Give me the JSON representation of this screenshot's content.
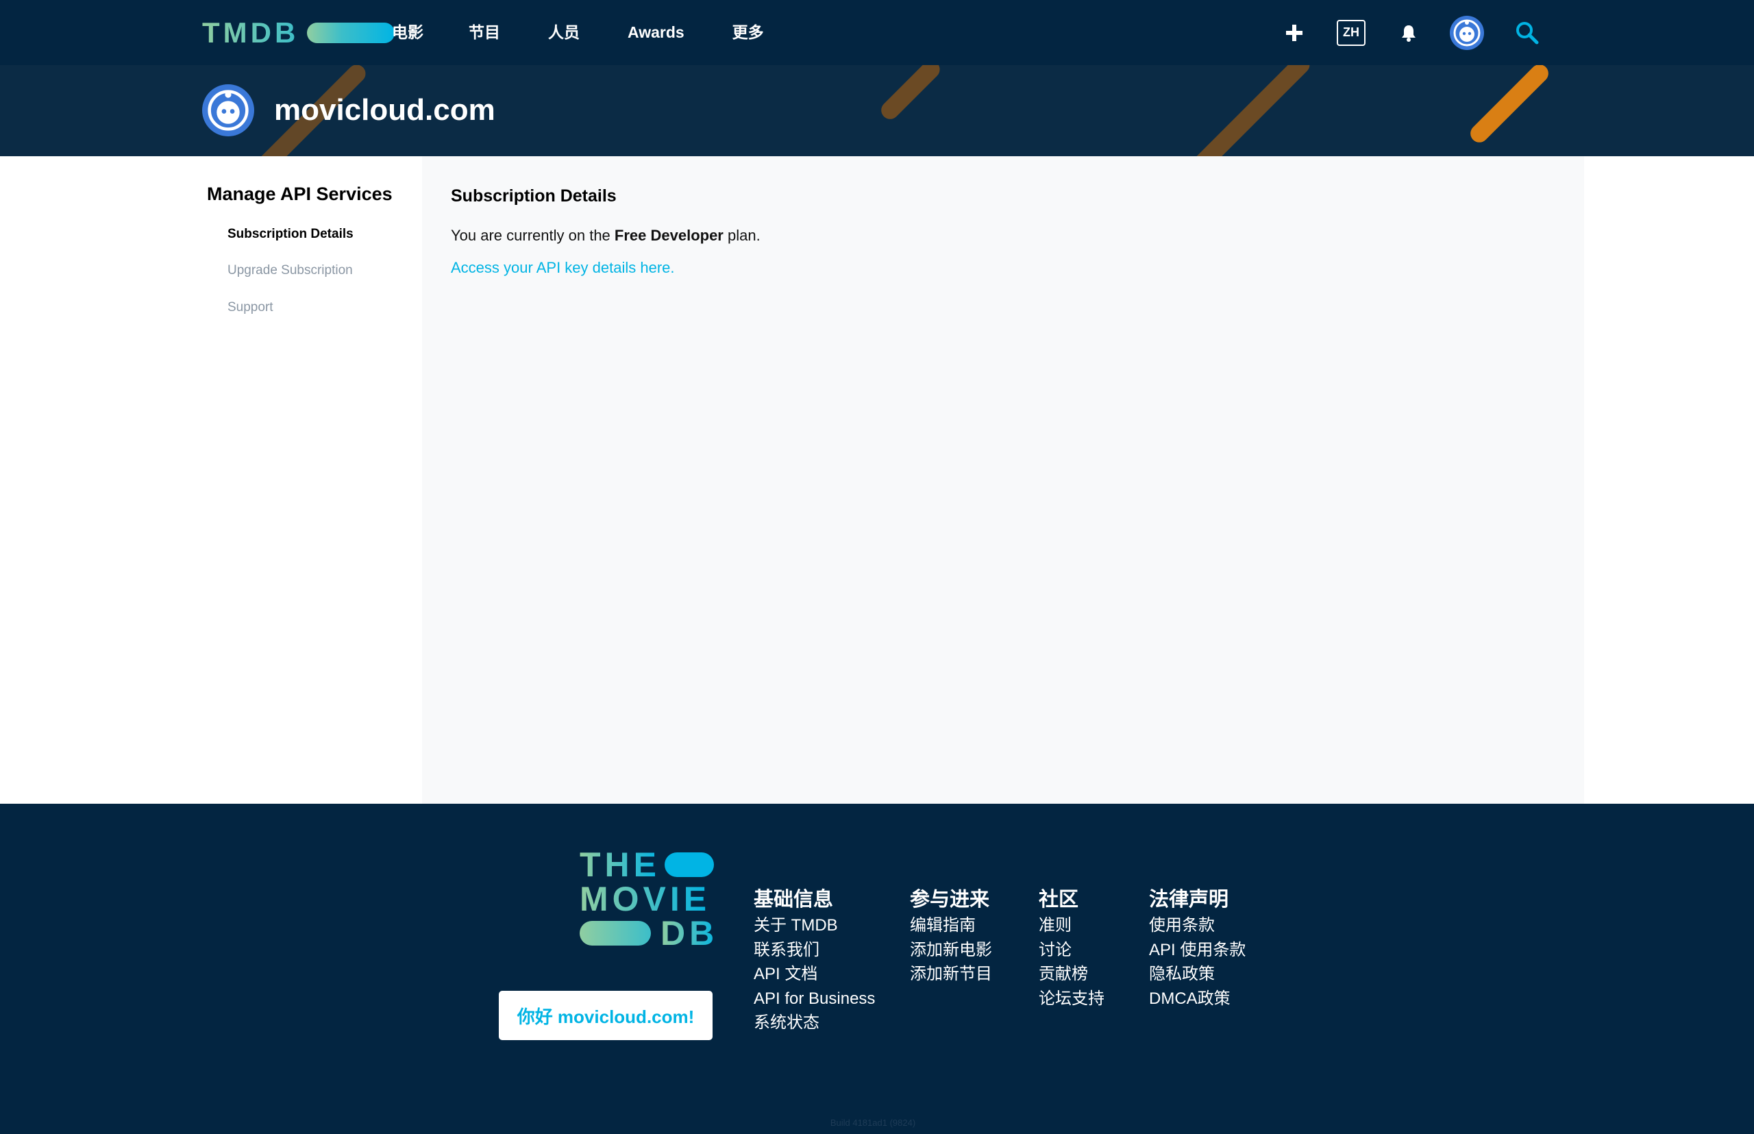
{
  "nav": {
    "logo_text": "TMDB",
    "links": [
      "电影",
      "节目",
      "人员",
      "Awards",
      "更多"
    ],
    "language": "ZH",
    "icons": [
      "plus-icon",
      "bell-icon",
      "avatar",
      "search-icon"
    ]
  },
  "banner": {
    "title": "movicloud.com"
  },
  "sidebar": {
    "title": "Manage API Services",
    "items": [
      {
        "label": "Subscription Details",
        "active": true
      },
      {
        "label": "Upgrade Subscription",
        "active": false
      },
      {
        "label": "Support",
        "active": false
      }
    ]
  },
  "content": {
    "title": "Subscription Details",
    "text_before": "You are currently on the ",
    "plan": "Free Developer",
    "text_after": " plan.",
    "link": "Access your API key details here."
  },
  "footer": {
    "logo_lines": [
      "THE",
      "MOVIE",
      "DB"
    ],
    "greeting": "你好 movicloud.com!",
    "columns": [
      {
        "title": "基础信息",
        "items": [
          "关于 TMDB",
          "联系我们",
          "API 文档",
          "API for Business",
          "系统状态"
        ]
      },
      {
        "title": "参与进来",
        "items": [
          "编辑指南",
          "添加新电影",
          "添加新节目"
        ]
      },
      {
        "title": "社区",
        "items": [
          "准则",
          "讨论",
          "贡献榜",
          "论坛支持"
        ]
      },
      {
        "title": "法律声明",
        "items": [
          "使用条款",
          "API 使用条款",
          "隐私政策",
          "DMCA政策"
        ]
      }
    ],
    "build": "Build 4181ad1 (9824)"
  },
  "colors": {
    "navy": "#032541",
    "accent": "#01b4e4",
    "green": "#90cea1",
    "orange": "#d97f14"
  }
}
